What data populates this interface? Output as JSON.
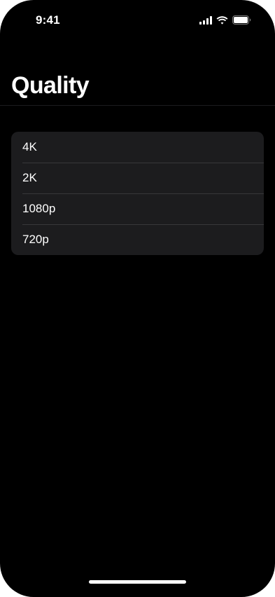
{
  "status_bar": {
    "time": "9:41",
    "icons": [
      "cellular-signal-icon",
      "wifi-icon",
      "battery-icon"
    ]
  },
  "header": {
    "title": "Quality"
  },
  "quality_list": {
    "items": [
      {
        "label": "4K"
      },
      {
        "label": "2K"
      },
      {
        "label": "1080p"
      },
      {
        "label": "720p"
      }
    ]
  },
  "colors": {
    "background": "#000000",
    "card": "#1c1c1e",
    "separator": "#38383a",
    "text": "#ffffff"
  }
}
